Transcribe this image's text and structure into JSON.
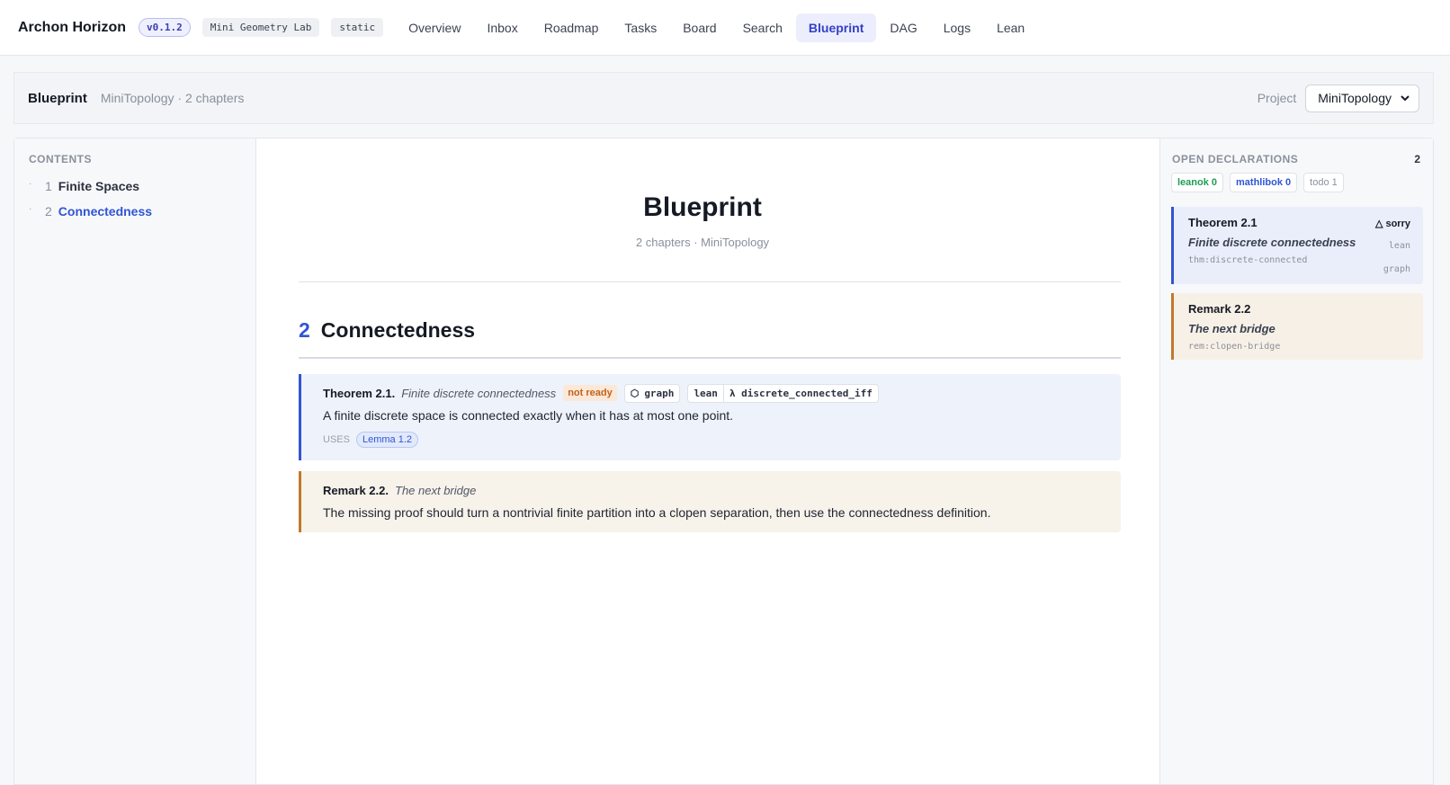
{
  "app": {
    "brand": "Archon Horizon",
    "version": "v0.1.2",
    "workspace": "Mini Geometry Lab",
    "mode": "static"
  },
  "nav": {
    "items": [
      "Overview",
      "Inbox",
      "Roadmap",
      "Tasks",
      "Board",
      "Search",
      "Blueprint",
      "DAG",
      "Logs",
      "Lean"
    ],
    "active": "Blueprint"
  },
  "header": {
    "title": "Blueprint",
    "meta": "MiniTopology · 2 chapters",
    "project_label": "Project",
    "project_value": "MiniTopology"
  },
  "toc": {
    "heading": "CONTENTS",
    "items": [
      {
        "num": "1",
        "label": "Finite Spaces",
        "active": false
      },
      {
        "num": "2",
        "label": "Connectedness",
        "active": true
      }
    ]
  },
  "doc": {
    "title": "Blueprint",
    "subtitle": "2 chapters · MiniTopology",
    "chapter_num": "2",
    "chapter_title": "Connectedness",
    "theorem": {
      "kind": "Theorem 2.1.",
      "name": "Finite discrete connectedness",
      "status": "not ready",
      "graph_tag": "graph",
      "lean_tag": "lean",
      "lean_decl": "λ discrete_connected_iff",
      "body": "A finite discrete space is connected exactly when it has at most one point.",
      "uses_label": "USES",
      "uses_link": "Lemma 1.2"
    },
    "remark": {
      "kind": "Remark 2.2.",
      "name": "The next bridge",
      "body": "The missing proof should turn a nontrivial finite partition into a clopen separation, then use the connectedness definition."
    }
  },
  "sidebar": {
    "heading": "OPEN DECLARATIONS",
    "count": "2",
    "pills": {
      "leanok": "leanok 0",
      "mathlibok": "mathlibok 0",
      "todo": "todo 1"
    },
    "cards": [
      {
        "kind": "Theorem 2.1",
        "name": "Finite discrete connectedness",
        "label": "thm:discrete-connected",
        "status": "△ sorry",
        "link1": "lean",
        "link2": "graph"
      },
      {
        "kind": "Remark 2.2",
        "name": "The next bridge",
        "label": "rem:clopen-bridge"
      }
    ]
  },
  "colors": {
    "accent": "#3340c6",
    "theorem_border": "#3554d1",
    "remark_border": "#c07a2c",
    "not_ready": "#c4621a"
  }
}
